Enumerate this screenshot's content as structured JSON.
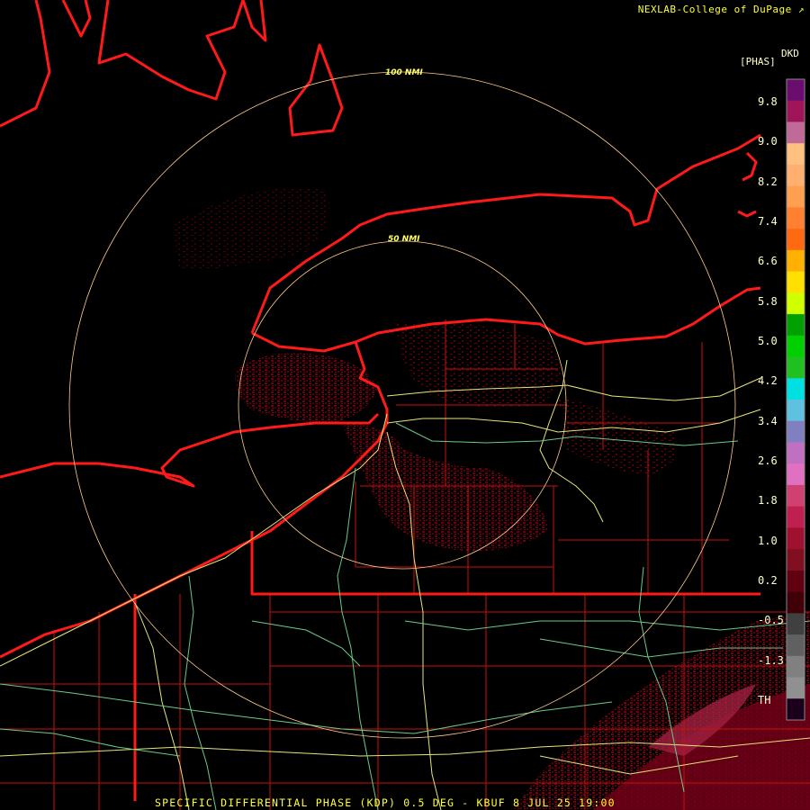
{
  "header": {
    "credit": "NEXLAB-College of DuPage"
  },
  "legend": {
    "product": "DKD",
    "unit": "[PHAS]",
    "ticks": [
      "9.8",
      "9.0",
      "8.2",
      "7.4",
      "6.6",
      "5.8",
      "5.0",
      "4.2",
      "3.4",
      "2.6",
      "1.8",
      "1.0",
      "0.2",
      "-0.5",
      "-1.3",
      "TH"
    ],
    "colors": [
      "#6a0d6e",
      "#a0155a",
      "#c06a9a",
      "#ffc080",
      "#ffb070",
      "#ffa050",
      "#ff8030",
      "#ff6a10",
      "#ffb000",
      "#ffe000",
      "#d0ff00",
      "#00a000",
      "#00d000",
      "#20c020",
      "#00e0e0",
      "#60c0e0",
      "#8080c0",
      "#c070c0",
      "#e070c0",
      "#d04070",
      "#c02050",
      "#a01030",
      "#801020",
      "#600010",
      "#400008",
      "#404040",
      "#606060",
      "#808080",
      "#909090",
      "#1a001a"
    ]
  },
  "rings": [
    {
      "label": "50 NMI"
    },
    {
      "label": "100 NMI"
    }
  ],
  "footer": {
    "caption": "SPECIFIC DIFFERENTIAL PHASE (KDP) 0.5 DEG - KBUF 8 JUL 25 19:00"
  },
  "colors": {
    "border": "#ff1a1a",
    "county": "#c81010",
    "highway_yellow": "#e6e67a",
    "highway_green": "#66cc88",
    "ring": "#ffcc88",
    "echo": "#6b0010"
  }
}
